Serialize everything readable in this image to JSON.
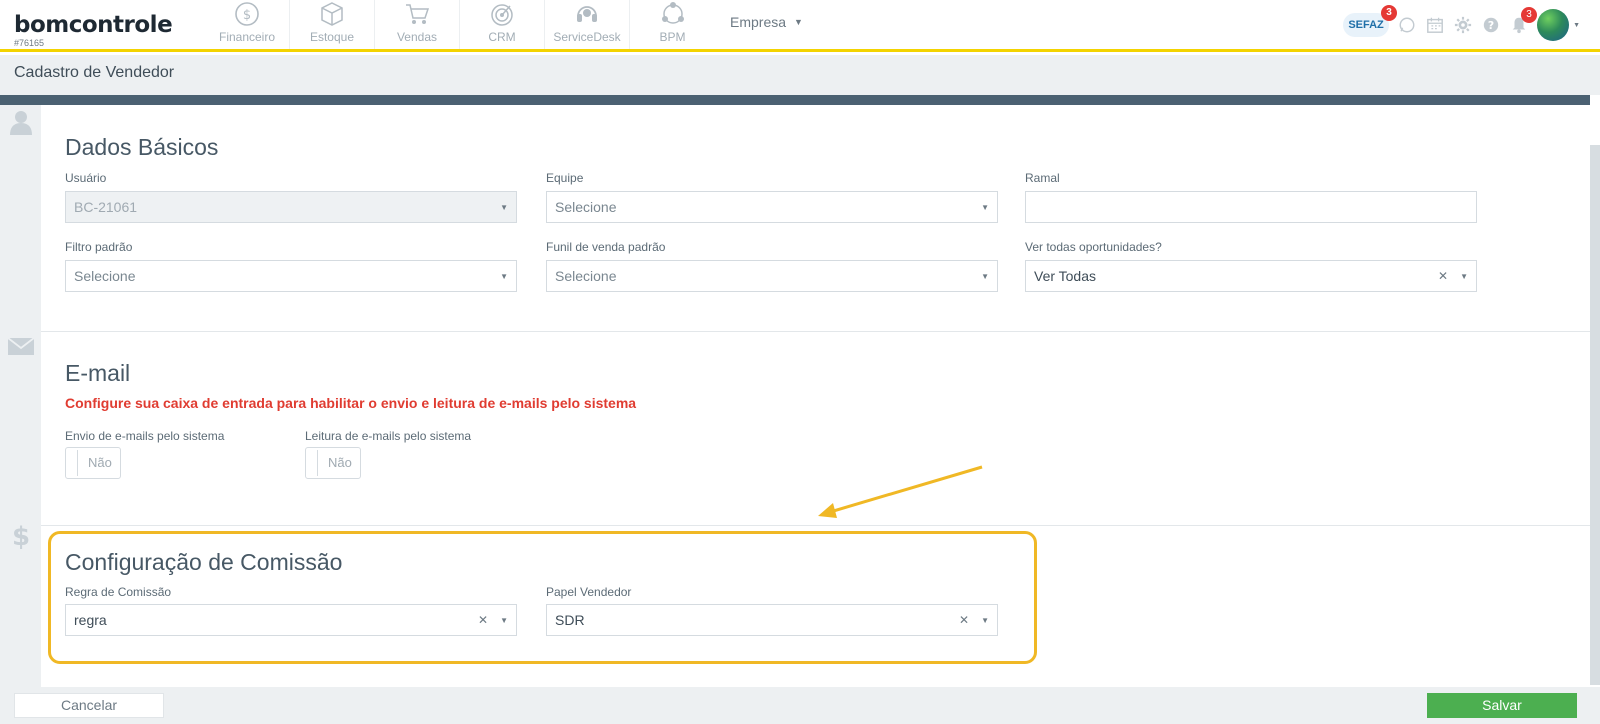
{
  "app": {
    "logo_text": "bomcontrole",
    "account_id": "#76165",
    "company_selector": "Empresa"
  },
  "modules": [
    {
      "label": "Financeiro",
      "icon": "money-icon"
    },
    {
      "label": "Estoque",
      "icon": "box-icon"
    },
    {
      "label": "Vendas",
      "icon": "cart-icon"
    },
    {
      "label": "CRM",
      "icon": "target-icon"
    },
    {
      "label": "ServiceDesk",
      "icon": "headset-icon"
    },
    {
      "label": "BPM",
      "icon": "network-icon"
    }
  ],
  "header_icons": {
    "sefaz_label": "SEFAZ",
    "sefaz_badge": "3",
    "notifications_badge": "3"
  },
  "page": {
    "title": "Cadastro de Vendedor"
  },
  "dados_basicos": {
    "title": "Dados Básicos",
    "usuario_label": "Usuário",
    "usuario_value": "BC-21061",
    "equipe_label": "Equipe",
    "equipe_value": "Selecione",
    "ramal_label": "Ramal",
    "ramal_value": "",
    "filtro_label": "Filtro padrão",
    "filtro_value": "Selecione",
    "funil_label": "Funil de venda padrão",
    "funil_value": "Selecione",
    "ver_todas_label": "Ver todas oportunidades?",
    "ver_todas_value": "Ver Todas"
  },
  "email": {
    "title": "E-mail",
    "warning": "Configure sua caixa de entrada para habilitar o envio e leitura de e-mails pelo sistema",
    "envio_label": "Envio de e-mails pelo sistema",
    "envio_value": "Não",
    "leitura_label": "Leitura de e-mails pelo sistema",
    "leitura_value": "Não"
  },
  "comissao": {
    "title": "Configuração de Comissão",
    "regra_label": "Regra de Comissão",
    "regra_value": "regra",
    "papel_label": "Papel Vendedor",
    "papel_value": "SDR"
  },
  "footer": {
    "cancel_label": "Cancelar",
    "save_label": "Salvar"
  },
  "colors": {
    "accent_yellow": "#f3d300",
    "warning_red": "#e03c31",
    "save_green": "#4caf50",
    "annotation_orange": "#f0b825"
  }
}
